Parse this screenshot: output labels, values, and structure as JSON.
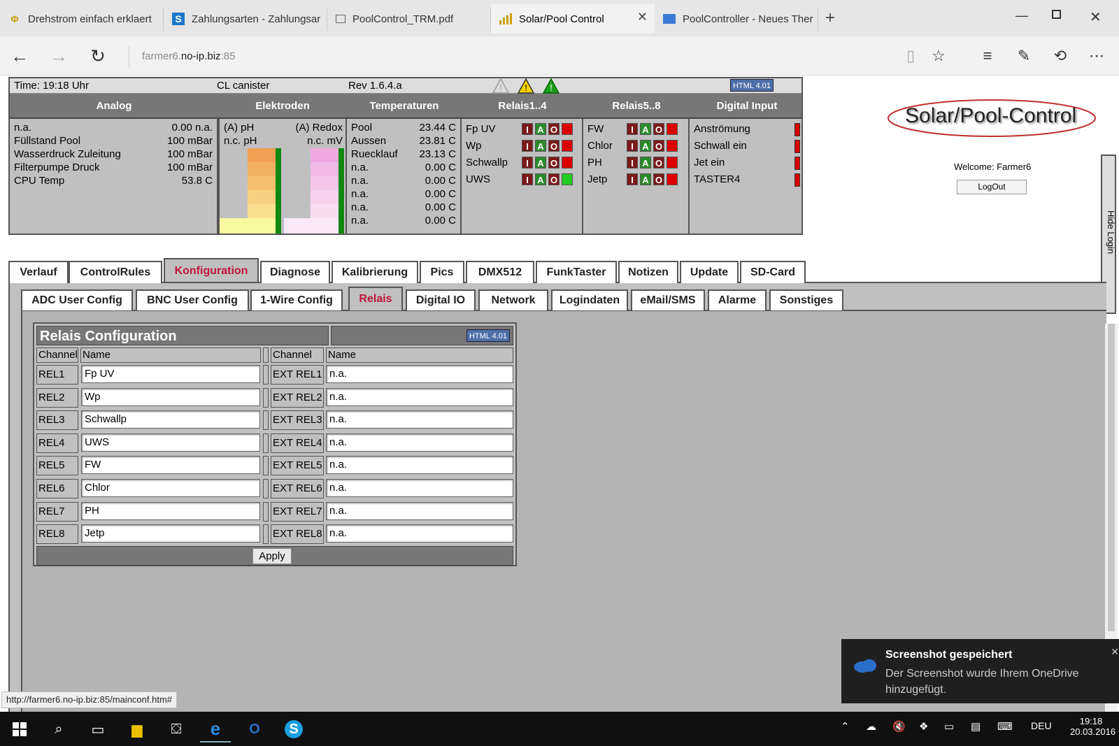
{
  "browser": {
    "tabs": [
      {
        "icon": "phi-icon",
        "label": "Drehstrom einfach erklaert"
      },
      {
        "icon": "s-icon",
        "label": "Zahlungsarten - Zahlungsar"
      },
      {
        "icon": "document-icon",
        "label": "PoolControl_TRM.pdf"
      },
      {
        "icon": "signal-bars-icon",
        "label": "Solar/Pool Control"
      },
      {
        "icon": "site-icon",
        "label": "PoolController - Neues Ther"
      }
    ],
    "url_prefix": "farmer6.",
    "url_host": "no-ip.biz",
    "url_port": ":85",
    "status_url": "http://farmer6.no-ip.biz:85/mainconf.htm#"
  },
  "status": {
    "time": "Time: 19:18 Uhr",
    "mode": "CL canister",
    "rev": "Rev 1.6.4.a",
    "badge": "HTML 4.01",
    "headers": [
      "Analog",
      "Elektroden",
      "Temperaturen",
      "Relais1..4",
      "Relais5..8",
      "Digital Input"
    ],
    "analog": [
      {
        "name": "n.a.",
        "value": "0.00 n.a."
      },
      {
        "name": "Füllstand Pool",
        "value": "100 mBar"
      },
      {
        "name": "Wasserdruck Zuleitung",
        "value": "100 mBar"
      },
      {
        "name": "Filterpumpe Druck",
        "value": "100 mBar"
      },
      {
        "name": "CPU Temp",
        "value": "53.8 C"
      }
    ],
    "elektroden": {
      "ph_label": "(A) pH",
      "ph_sub": "n.c. pH",
      "redox_label": "(A) Redox",
      "redox_sub": "n.c. mV"
    },
    "temperaturen": [
      {
        "name": "Pool",
        "value": "23.44 C"
      },
      {
        "name": "Aussen",
        "value": "23.81 C"
      },
      {
        "name": "Ruecklauf",
        "value": "23.13 C"
      },
      {
        "name": "n.a.",
        "value": "0.00 C"
      },
      {
        "name": "n.a.",
        "value": "0.00 C"
      },
      {
        "name": "n.a.",
        "value": "0.00 C"
      },
      {
        "name": "n.a.",
        "value": "0.00 C"
      },
      {
        "name": "n.a.",
        "value": "0.00 C"
      }
    ],
    "relais1": [
      {
        "name": "Fp UV",
        "led": "red"
      },
      {
        "name": "Wp",
        "led": "red"
      },
      {
        "name": "Schwallp",
        "led": "red"
      },
      {
        "name": "UWS",
        "led": "green"
      }
    ],
    "relais2": [
      {
        "name": "FW",
        "led": "red"
      },
      {
        "name": "Chlor",
        "led": "red"
      },
      {
        "name": "PH",
        "led": "red"
      },
      {
        "name": "Jetp",
        "led": "red"
      }
    ],
    "relais_buttons": [
      "I",
      "A",
      "O"
    ],
    "digital": [
      "Anströmung",
      "Schwall ein",
      "Jet ein",
      "TASTER4"
    ]
  },
  "side": {
    "logo": "Solar/Pool-Control",
    "welcome": "Welcome:  Farmer6",
    "logout": "LogOut",
    "hide_login": "Hide Login"
  },
  "main_tabs": [
    "Verlauf",
    "ControlRules",
    "Konfiguration",
    "Diagnose",
    "Kalibrierung",
    "Pics",
    "DMX512",
    "FunkTaster",
    "Notizen",
    "Update",
    "SD-Card"
  ],
  "sub_tabs": [
    "ADC User Config",
    "BNC User Config",
    "1-Wire Config",
    "Relais",
    "Digital IO",
    "Network",
    "Logindaten",
    "eMail/SMS",
    "Alarme",
    "Sonstiges"
  ],
  "relais_config": {
    "title": "Relais Configuration",
    "badge": "HTML 4.01",
    "col_channel": "Channel",
    "col_name": "Name",
    "rows": [
      {
        "ch": "REL1",
        "name": "Fp  UV",
        "ext": "EXT REL1",
        "ext_name": "n.a."
      },
      {
        "ch": "REL2",
        "name": "Wp",
        "ext": "EXT REL2",
        "ext_name": "n.a."
      },
      {
        "ch": "REL3",
        "name": "Schwallp",
        "ext": "EXT REL3",
        "ext_name": "n.a."
      },
      {
        "ch": "REL4",
        "name": "UWS",
        "ext": "EXT REL4",
        "ext_name": "n.a."
      },
      {
        "ch": "REL5",
        "name": "FW",
        "ext": "EXT REL5",
        "ext_name": "n.a."
      },
      {
        "ch": "REL6",
        "name": "Chlor",
        "ext": "EXT REL6",
        "ext_name": "n.a."
      },
      {
        "ch": "REL7",
        "name": "PH",
        "ext": "EXT REL7",
        "ext_name": "n.a."
      },
      {
        "ch": "REL8",
        "name": "Jetp",
        "ext": "EXT REL8",
        "ext_name": "n.a."
      }
    ],
    "apply": "Apply"
  },
  "toast": {
    "title": "Screenshot gespeichert",
    "body": "Der Screenshot wurde Ihrem OneDrive hinzugefügt."
  },
  "taskbar": {
    "lang": "DEU",
    "time": "19:18",
    "date": "20.03.2016"
  }
}
